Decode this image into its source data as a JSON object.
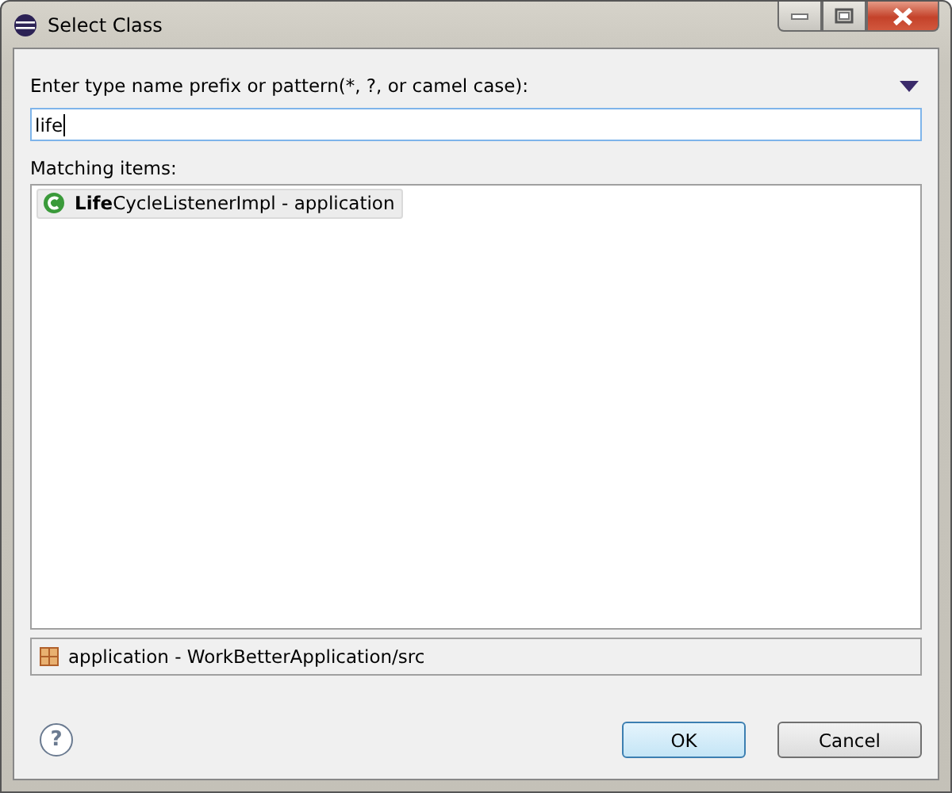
{
  "window": {
    "title": "Select Class"
  },
  "pattern": {
    "label": "Enter type name prefix or pattern(*, ?, or camel case):",
    "value": "life"
  },
  "matching": {
    "label": "Matching items:",
    "items": [
      {
        "text": "**Life**CycleListenerImpl - application",
        "selected": true
      }
    ]
  },
  "status_bar": {
    "text": "application - WorkBetterApplication/src"
  },
  "help": {
    "glyph": "?"
  },
  "buttons": [
    {
      "label": "OK",
      "default": true
    },
    {
      "label": "Cancel",
      "default": false
    }
  ]
}
